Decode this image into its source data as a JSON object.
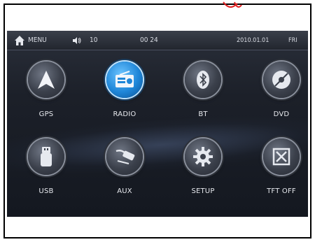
{
  "status": {
    "menu_label": "MENU",
    "volume": "10",
    "time": "00 24",
    "date": "2010.01.01",
    "day": "FRI"
  },
  "apps": [
    {
      "label": "GPS",
      "icon": "navigation-arrow-icon",
      "active": false
    },
    {
      "label": "RADIO",
      "icon": "radio-icon",
      "active": true
    },
    {
      "label": "BT",
      "icon": "bluetooth-icon",
      "active": false
    },
    {
      "label": "DVD",
      "icon": "disc-icon",
      "active": false
    },
    {
      "label": "USB",
      "icon": "usb-icon",
      "active": false
    },
    {
      "label": "AUX",
      "icon": "aux-cable-icon",
      "active": false
    },
    {
      "label": "SETUP",
      "icon": "gear-icon",
      "active": false
    },
    {
      "label": "TFT OFF",
      "icon": "screen-off-icon",
      "active": false
    }
  ],
  "colors": {
    "accent": "#1f86d8",
    "screen_bg": "#1c2029",
    "text": "#e7e9ee"
  }
}
